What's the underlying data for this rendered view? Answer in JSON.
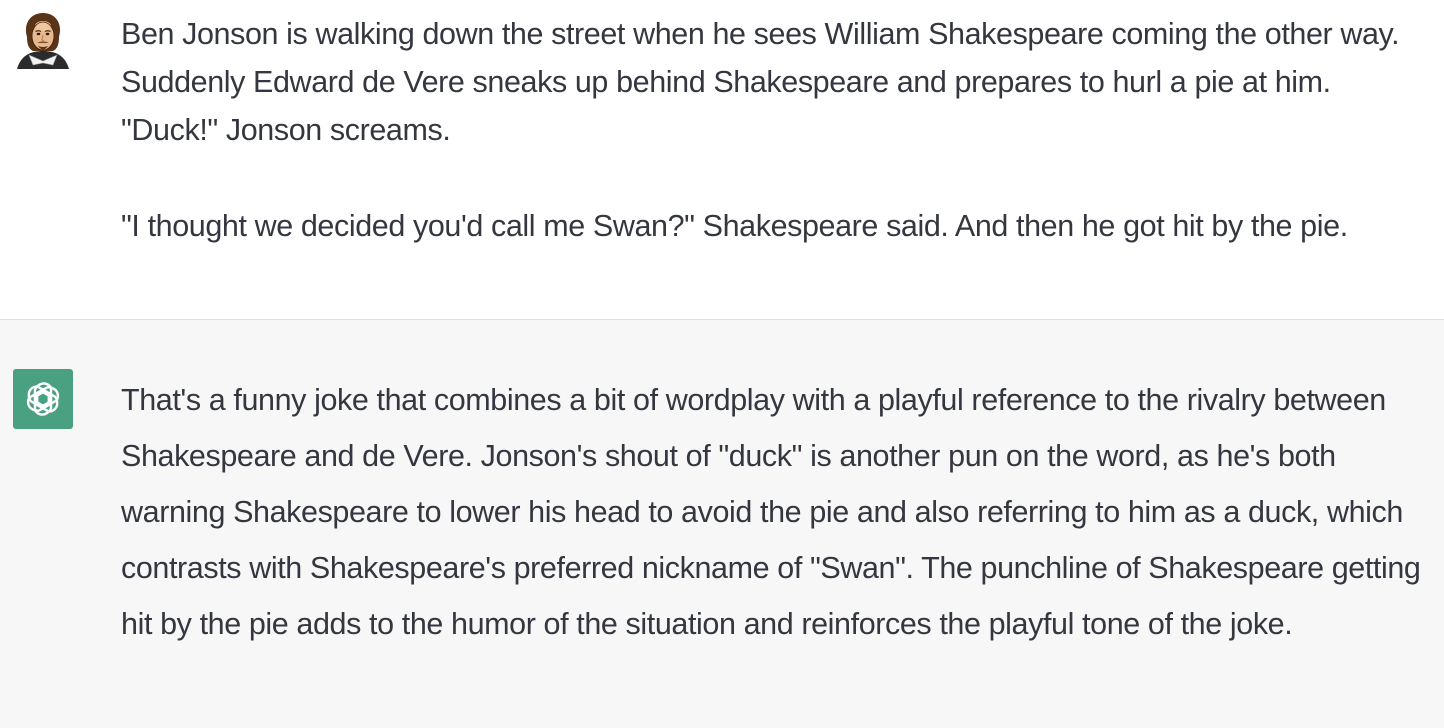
{
  "conversation": {
    "user_message": {
      "avatar_icon": "shakespeare-portrait-avatar",
      "text": "Ben Jonson is walking down the street when he sees William Shakespeare coming the other way. Suddenly Edward de Vere sneaks up behind Shakespeare and prepares to hurl a pie at him. \"Duck!\" Jonson screams.\n\n\"I thought we decided you'd call me Swan?\" Shakespeare said. And then he got hit by the pie."
    },
    "assistant_message": {
      "avatar_icon": "openai-logo",
      "avatar_color": "#4aa181",
      "text": "That's a funny joke that combines a bit of wordplay with a playful reference to the rivalry between Shakespeare and de Vere. Jonson's shout of \"duck\" is another pun on the word, as he's both warning Shakespeare to lower his head to avoid the pie and also referring to him as a duck, which contrasts with Shakespeare's preferred nickname of \"Swan\". The punchline of Shakespeare getting hit by the pie adds to the humor of the situation and reinforces the playful tone of the joke."
    }
  },
  "colors": {
    "user_background": "#ffffff",
    "assistant_background": "#f7f7f8",
    "text": "#353740",
    "divider": "#dedee3"
  }
}
